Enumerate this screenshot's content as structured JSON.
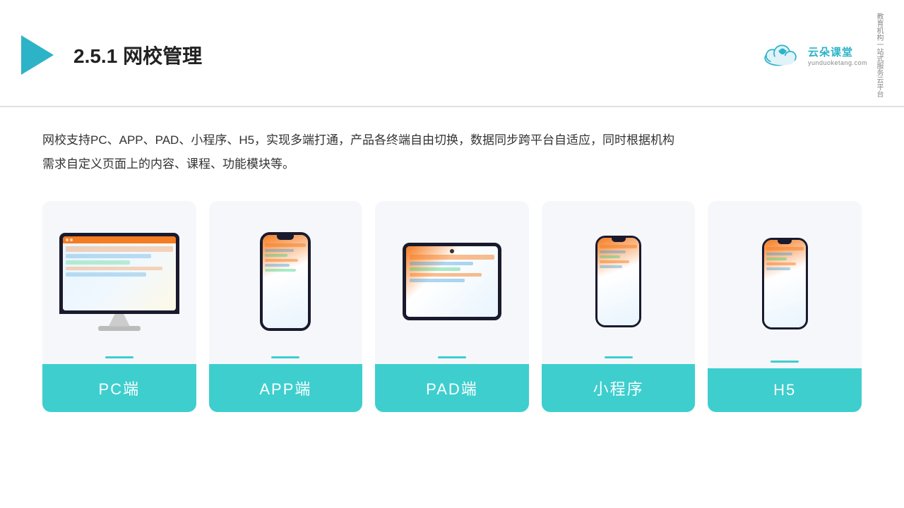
{
  "header": {
    "title": "2.5.1网校管理",
    "title_prefix": "2.5.1",
    "title_main": "网校管理"
  },
  "brand": {
    "name": "云朵课堂",
    "url": "yunduoketang.com",
    "tagline": "教育机构一站式服务云平台"
  },
  "description": {
    "line1": "网校支持PC、APP、PAD、小程序、H5，实现多端打通，产品各终端自由切换，数据同步跨平台自适应，同时根据机构",
    "line2": "需求自定义页面上的内容、课程、功能模块等。"
  },
  "cards": [
    {
      "id": "pc",
      "label": "PC端",
      "device_type": "monitor"
    },
    {
      "id": "app",
      "label": "APP端",
      "device_type": "phone"
    },
    {
      "id": "pad",
      "label": "PAD端",
      "device_type": "tablet"
    },
    {
      "id": "miniprogram",
      "label": "小程序",
      "device_type": "phone_small"
    },
    {
      "id": "h5",
      "label": "H5",
      "device_type": "phone_small"
    }
  ]
}
